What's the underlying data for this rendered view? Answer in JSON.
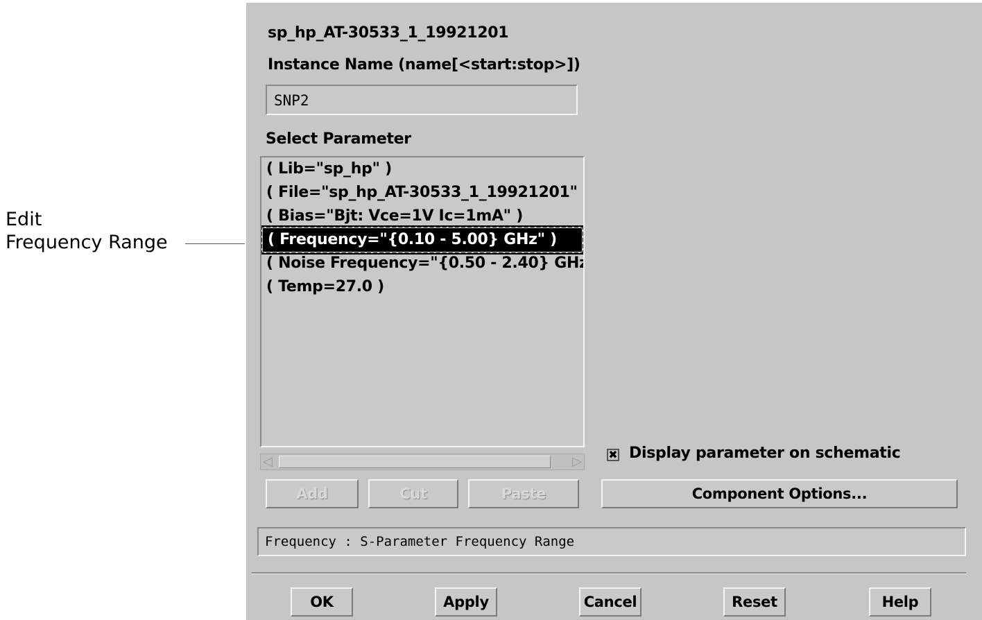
{
  "callout": {
    "line1": "Edit",
    "line2": "Frequency Range"
  },
  "dialog": {
    "component_title": "sp_hp_AT-30533_1_19921201",
    "instance_label": "Instance Name  (name[<start:stop>])",
    "instance_value": "SNP2",
    "select_label": "Select Parameter",
    "parameters": [
      "( Lib=\"sp_hp\" )",
      "( File=\"sp_hp_AT-30533_1_19921201\"",
      "( Bias=\"Bjt: Vce=1V Ic=1mA\" )",
      "( Frequency=\"{0.10 - 5.00} GHz\" )",
      "( Noise Frequency=\"{0.50 - 2.40} GHz",
      "( Temp=27.0 )"
    ],
    "selected_index": 3,
    "edit_buttons": {
      "add": "Add",
      "cut": "Cut",
      "paste": "Paste"
    },
    "display_checkbox": {
      "label": "Display parameter on schematic",
      "checked": true,
      "mark": "✖"
    },
    "component_options": "Component Options...",
    "status_text": "Frequency : S-Parameter Frequency Range",
    "footer_buttons": {
      "ok": "OK",
      "apply": "Apply",
      "cancel": "Cancel",
      "reset": "Reset",
      "help": "Help"
    },
    "scroll_left_icon": "◁",
    "scroll_right_icon": "▷"
  },
  "colors": {
    "dialog_bg": "#c6c6c6",
    "selection_bg": "#000000",
    "selection_fg": "#ffffff"
  }
}
